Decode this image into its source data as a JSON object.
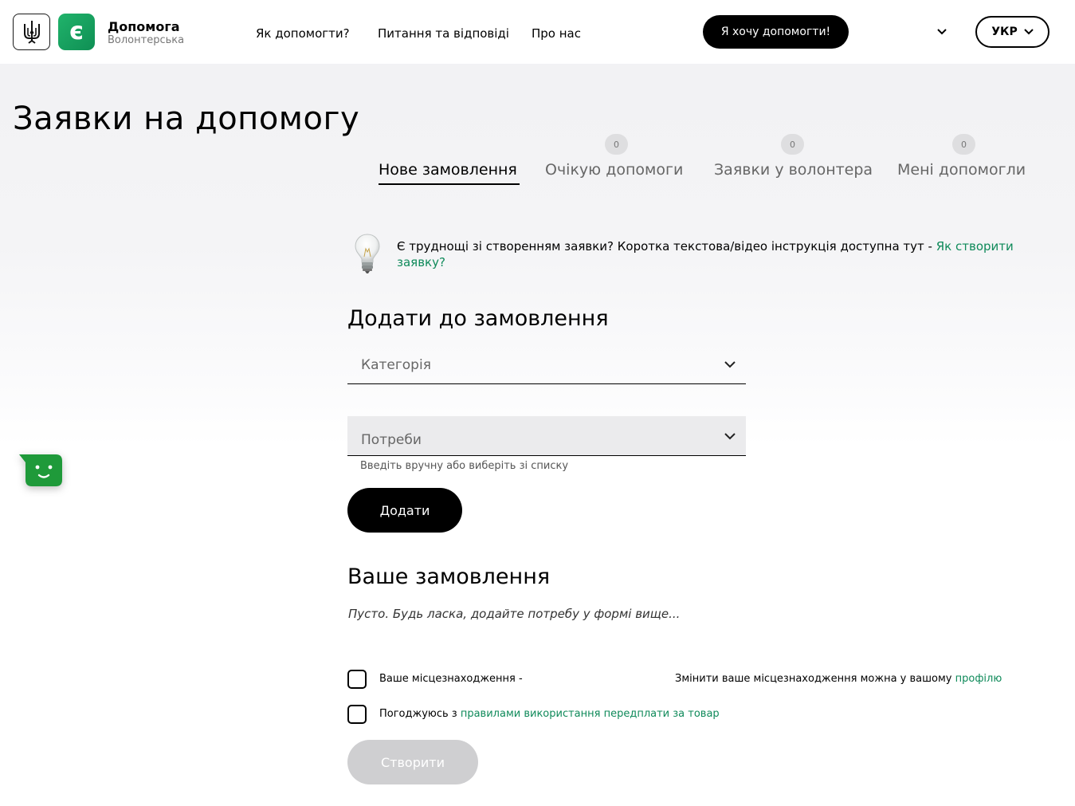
{
  "header": {
    "brand_title": "Допомога",
    "brand_sub": "Волонтерська",
    "nav": [
      "Як допомогти?",
      "Питання та відповіді",
      "Про нас"
    ],
    "help_button": "Я хочу допомогти!",
    "language": "УКР",
    "logo_letter": "є"
  },
  "page": {
    "title": "Заявки на допомогу"
  },
  "tabs": [
    {
      "label": "Нове замовлення",
      "active": true
    },
    {
      "label": "Очікую допомоги",
      "count": "0"
    },
    {
      "label": "Заявки у волонтера",
      "count": "0"
    },
    {
      "label": "Мені допомогли",
      "count": "0"
    }
  ],
  "hint": {
    "text": "Є труднощі зі створенням заявки? Коротка текстова/відео інструкція доступна тут - ",
    "link": "Як створити заявку?"
  },
  "add_section": {
    "title": "Додати до замовлення",
    "category_placeholder": "Категорія",
    "needs_placeholder": "Потреби",
    "needs_helper": "Введіть вручну або виберіть зі списку",
    "add_button": "Додати"
  },
  "order_section": {
    "title": "Ваше замовлення",
    "empty_note": "Пусто. Будь ласка, додайте потребу у формі вище...",
    "location_label": "Ваше місцезнаходження -",
    "location_change_text": "Змінити ваше місцезнаходження можна у вашому ",
    "location_change_link": "профілю",
    "agree_text": "Погоджуюсь з ",
    "agree_link": "правилами використання передплати за товар",
    "create_button": "Створити"
  },
  "colors": {
    "accent_green": "#0f8a5a",
    "logo_green": "#1aa863",
    "chat_green": "#1f9a3a",
    "disabled": "#cfcfd1"
  },
  "icons": [
    "trident-icon",
    "diia-logo-icon",
    "chevron-down-icon",
    "lightbulb-icon",
    "chat-bot-icon"
  ]
}
